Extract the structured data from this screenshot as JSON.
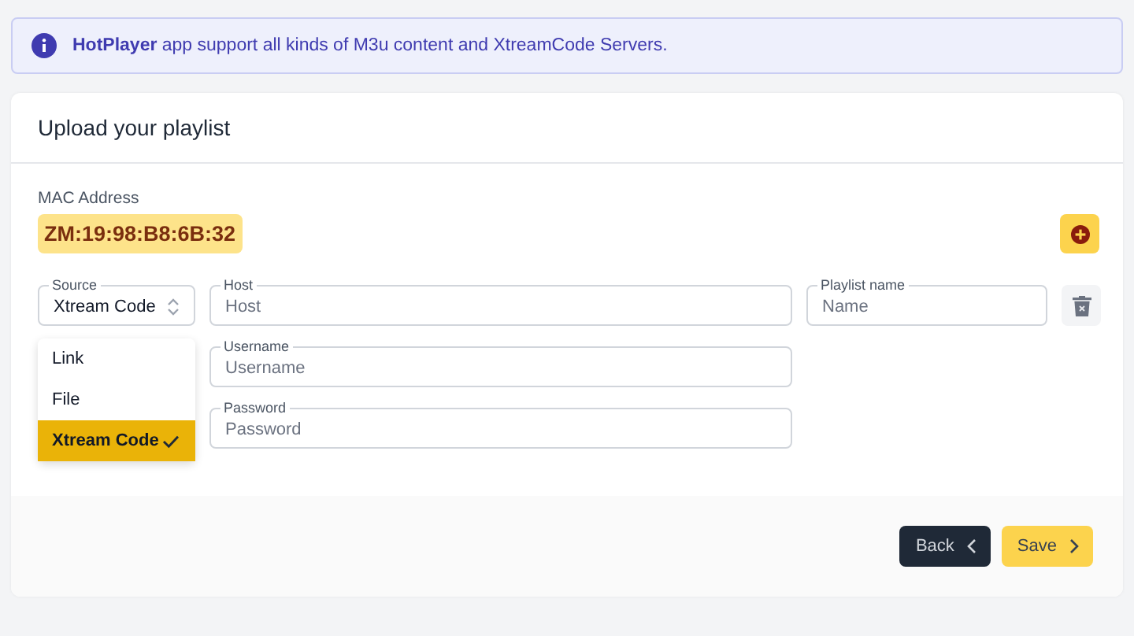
{
  "alert": {
    "text": "**HotPlayer** app support all kinds of M3u content and XtreamCode Servers."
  },
  "card": {
    "title": "Upload your playlist"
  },
  "mac": {
    "label": "MAC Address",
    "value": "ZM:19:98:B8:6B:32"
  },
  "source": {
    "label": "Source",
    "value": "Xtream Code",
    "expanded": true,
    "options": [
      {
        "label": "Link",
        "selected": false
      },
      {
        "label": "File",
        "selected": false
      },
      {
        "label": "Xtream Code",
        "selected": true
      }
    ]
  },
  "host": {
    "label": "Host",
    "placeholder": "Host"
  },
  "playlist_name": {
    "label": "Playlist name",
    "placeholder": "Name"
  },
  "username": {
    "label": "Username",
    "placeholder": "Username"
  },
  "password": {
    "label": "Password",
    "placeholder": "Password"
  },
  "buttons": [
    {
      "label": "Back",
      "kind": "back"
    },
    {
      "label": "Save",
      "kind": "save"
    }
  ]
}
